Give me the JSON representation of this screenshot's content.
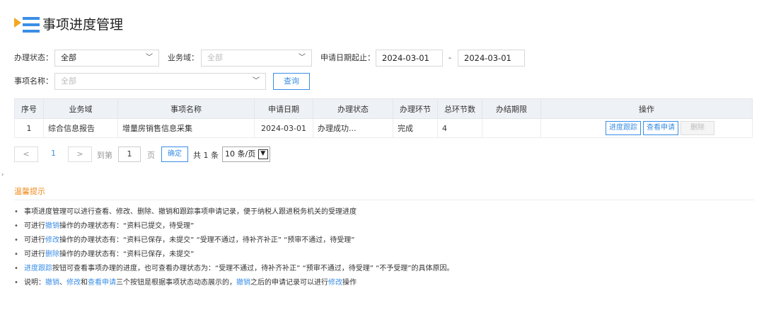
{
  "header": {
    "title": "事项进度管理"
  },
  "filters": {
    "status_label": "办理状态：",
    "status_value": "全部",
    "domain_label": "业务域：",
    "domain_placeholder": "全部",
    "date_label": "申请日期起止：",
    "date_start": "2024-03-01",
    "date_sep": "-",
    "date_end": "2024-03-01",
    "name_label": "事项名称：",
    "name_placeholder": "全部",
    "query_button": "查询"
  },
  "table": {
    "headers": [
      "序号",
      "业务域",
      "事项名称",
      "申请日期",
      "办理状态",
      "办理环节",
      "总环节数",
      "办结期限",
      "操作"
    ],
    "rows": [
      {
        "no": "1",
        "domain": "综合信息报告",
        "name": "增量房销售信息采集",
        "date": "2024-03-01",
        "status": "办理成功...",
        "step": "完成",
        "total": "4",
        "deadline": ""
      }
    ],
    "actions": {
      "track": "进度跟踪",
      "view": "查看申请",
      "delete": "删除"
    }
  },
  "pager": {
    "prev": "<",
    "current": "1",
    "next": ">",
    "goto_label": "到第",
    "page_value": "1",
    "page_unit": "页",
    "confirm": "确定",
    "total": "共 1 条",
    "size": "10 条/页"
  },
  "tips": {
    "title": "温馨提示",
    "l1": "事项进度管理可以进行查看、修改、删除、撤销和跟踪事项申请记录，便于纳税人跟进税务机关的受理进度",
    "l2a": "可进行",
    "l2b": "撤销",
    "l2c": "操作的办理状态有：“资料已提交，待受理”",
    "l3a": "可进行",
    "l3b": "修改",
    "l3c": "操作的办理状态有：“资料已保存，未提交” “受理不通过，待补齐补正” “预审不通过，待受理”",
    "l4a": "可进行",
    "l4b": "删除",
    "l4c": "操作的办理状态有：“资料已保存，未提交”",
    "l5a": "进度跟踪",
    "l5b": "按钮可查看事项办理的进度，也可查看办理状态为：“受理不通过，待补齐补正” “预审不通过，待受理” “不予受理”的具体原因。",
    "l6a": "说明：",
    "l6b": "撤销",
    "l6c": "、",
    "l6d": "修改",
    "l6e": "和",
    "l6f": "查看申请",
    "l6g": "三个按钮是根据事项状态动态展示的，",
    "l6h": "撤销",
    "l6i": "之后的申请记录可以进行",
    "l6j": "修改",
    "l6k": "操作"
  },
  "colors": {
    "accent": "#3a8ee6",
    "tip_title": "#f08a1c",
    "logo_orange": "#f5a623"
  }
}
